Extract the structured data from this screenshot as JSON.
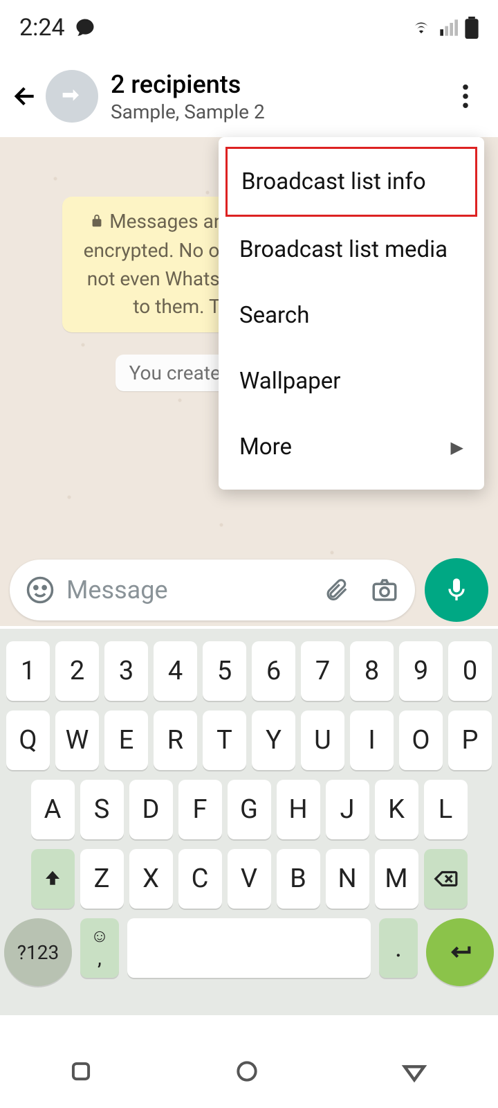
{
  "status": {
    "time": "2:24"
  },
  "header": {
    "title": "2 recipients",
    "subtitle": "Sample, Sample 2"
  },
  "chat": {
    "encrypt_notice": "Messages and calls are end-to-end encrypted. No one outside of this chat, not even WhatsApp, can read or listen to them. Tap to learn more.",
    "created_notice": "You created a broadcast list"
  },
  "menu": {
    "items": [
      {
        "label": "Broadcast list info",
        "highlighted": true
      },
      {
        "label": "Broadcast list media"
      },
      {
        "label": "Search"
      },
      {
        "label": "Wallpaper"
      },
      {
        "label": "More",
        "arrow": true
      }
    ]
  },
  "input": {
    "placeholder": "Message"
  },
  "keyboard": {
    "rows": {
      "nums": [
        "1",
        "2",
        "3",
        "4",
        "5",
        "6",
        "7",
        "8",
        "9",
        "0"
      ],
      "r1": [
        "Q",
        "W",
        "E",
        "R",
        "T",
        "Y",
        "U",
        "I",
        "O",
        "P"
      ],
      "r2": [
        "A",
        "S",
        "D",
        "F",
        "G",
        "H",
        "J",
        "K",
        "L"
      ],
      "r3": [
        "Z",
        "X",
        "C",
        "V",
        "B",
        "N",
        "M"
      ]
    },
    "sym": "?123",
    "comma": ",",
    "period": "."
  }
}
